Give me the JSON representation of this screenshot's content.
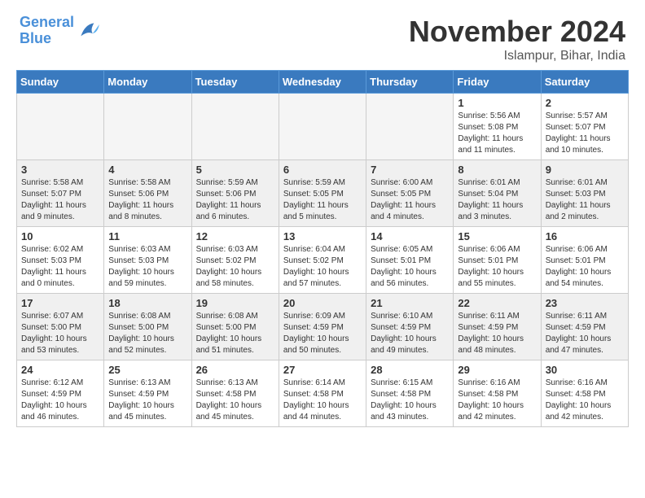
{
  "header": {
    "logo_text_general": "General",
    "logo_text_blue": "Blue",
    "month": "November 2024",
    "location": "Islampur, Bihar, India"
  },
  "weekdays": [
    "Sunday",
    "Monday",
    "Tuesday",
    "Wednesday",
    "Thursday",
    "Friday",
    "Saturday"
  ],
  "weeks": [
    [
      {
        "day": "",
        "empty": true
      },
      {
        "day": "",
        "empty": true
      },
      {
        "day": "",
        "empty": true
      },
      {
        "day": "",
        "empty": true
      },
      {
        "day": "",
        "empty": true
      },
      {
        "day": "1",
        "info": "Sunrise: 5:56 AM\nSunset: 5:08 PM\nDaylight: 11 hours and 11 minutes."
      },
      {
        "day": "2",
        "info": "Sunrise: 5:57 AM\nSunset: 5:07 PM\nDaylight: 11 hours and 10 minutes."
      }
    ],
    [
      {
        "day": "3",
        "info": "Sunrise: 5:58 AM\nSunset: 5:07 PM\nDaylight: 11 hours and 9 minutes."
      },
      {
        "day": "4",
        "info": "Sunrise: 5:58 AM\nSunset: 5:06 PM\nDaylight: 11 hours and 8 minutes."
      },
      {
        "day": "5",
        "info": "Sunrise: 5:59 AM\nSunset: 5:06 PM\nDaylight: 11 hours and 6 minutes."
      },
      {
        "day": "6",
        "info": "Sunrise: 5:59 AM\nSunset: 5:05 PM\nDaylight: 11 hours and 5 minutes."
      },
      {
        "day": "7",
        "info": "Sunrise: 6:00 AM\nSunset: 5:05 PM\nDaylight: 11 hours and 4 minutes."
      },
      {
        "day": "8",
        "info": "Sunrise: 6:01 AM\nSunset: 5:04 PM\nDaylight: 11 hours and 3 minutes."
      },
      {
        "day": "9",
        "info": "Sunrise: 6:01 AM\nSunset: 5:03 PM\nDaylight: 11 hours and 2 minutes."
      }
    ],
    [
      {
        "day": "10",
        "info": "Sunrise: 6:02 AM\nSunset: 5:03 PM\nDaylight: 11 hours and 0 minutes."
      },
      {
        "day": "11",
        "info": "Sunrise: 6:03 AM\nSunset: 5:03 PM\nDaylight: 10 hours and 59 minutes."
      },
      {
        "day": "12",
        "info": "Sunrise: 6:03 AM\nSunset: 5:02 PM\nDaylight: 10 hours and 58 minutes."
      },
      {
        "day": "13",
        "info": "Sunrise: 6:04 AM\nSunset: 5:02 PM\nDaylight: 10 hours and 57 minutes."
      },
      {
        "day": "14",
        "info": "Sunrise: 6:05 AM\nSunset: 5:01 PM\nDaylight: 10 hours and 56 minutes."
      },
      {
        "day": "15",
        "info": "Sunrise: 6:06 AM\nSunset: 5:01 PM\nDaylight: 10 hours and 55 minutes."
      },
      {
        "day": "16",
        "info": "Sunrise: 6:06 AM\nSunset: 5:01 PM\nDaylight: 10 hours and 54 minutes."
      }
    ],
    [
      {
        "day": "17",
        "info": "Sunrise: 6:07 AM\nSunset: 5:00 PM\nDaylight: 10 hours and 53 minutes."
      },
      {
        "day": "18",
        "info": "Sunrise: 6:08 AM\nSunset: 5:00 PM\nDaylight: 10 hours and 52 minutes."
      },
      {
        "day": "19",
        "info": "Sunrise: 6:08 AM\nSunset: 5:00 PM\nDaylight: 10 hours and 51 minutes."
      },
      {
        "day": "20",
        "info": "Sunrise: 6:09 AM\nSunset: 4:59 PM\nDaylight: 10 hours and 50 minutes."
      },
      {
        "day": "21",
        "info": "Sunrise: 6:10 AM\nSunset: 4:59 PM\nDaylight: 10 hours and 49 minutes."
      },
      {
        "day": "22",
        "info": "Sunrise: 6:11 AM\nSunset: 4:59 PM\nDaylight: 10 hours and 48 minutes."
      },
      {
        "day": "23",
        "info": "Sunrise: 6:11 AM\nSunset: 4:59 PM\nDaylight: 10 hours and 47 minutes."
      }
    ],
    [
      {
        "day": "24",
        "info": "Sunrise: 6:12 AM\nSunset: 4:59 PM\nDaylight: 10 hours and 46 minutes."
      },
      {
        "day": "25",
        "info": "Sunrise: 6:13 AM\nSunset: 4:59 PM\nDaylight: 10 hours and 45 minutes."
      },
      {
        "day": "26",
        "info": "Sunrise: 6:13 AM\nSunset: 4:58 PM\nDaylight: 10 hours and 45 minutes."
      },
      {
        "day": "27",
        "info": "Sunrise: 6:14 AM\nSunset: 4:58 PM\nDaylight: 10 hours and 44 minutes."
      },
      {
        "day": "28",
        "info": "Sunrise: 6:15 AM\nSunset: 4:58 PM\nDaylight: 10 hours and 43 minutes."
      },
      {
        "day": "29",
        "info": "Sunrise: 6:16 AM\nSunset: 4:58 PM\nDaylight: 10 hours and 42 minutes."
      },
      {
        "day": "30",
        "info": "Sunrise: 6:16 AM\nSunset: 4:58 PM\nDaylight: 10 hours and 42 minutes."
      }
    ]
  ]
}
